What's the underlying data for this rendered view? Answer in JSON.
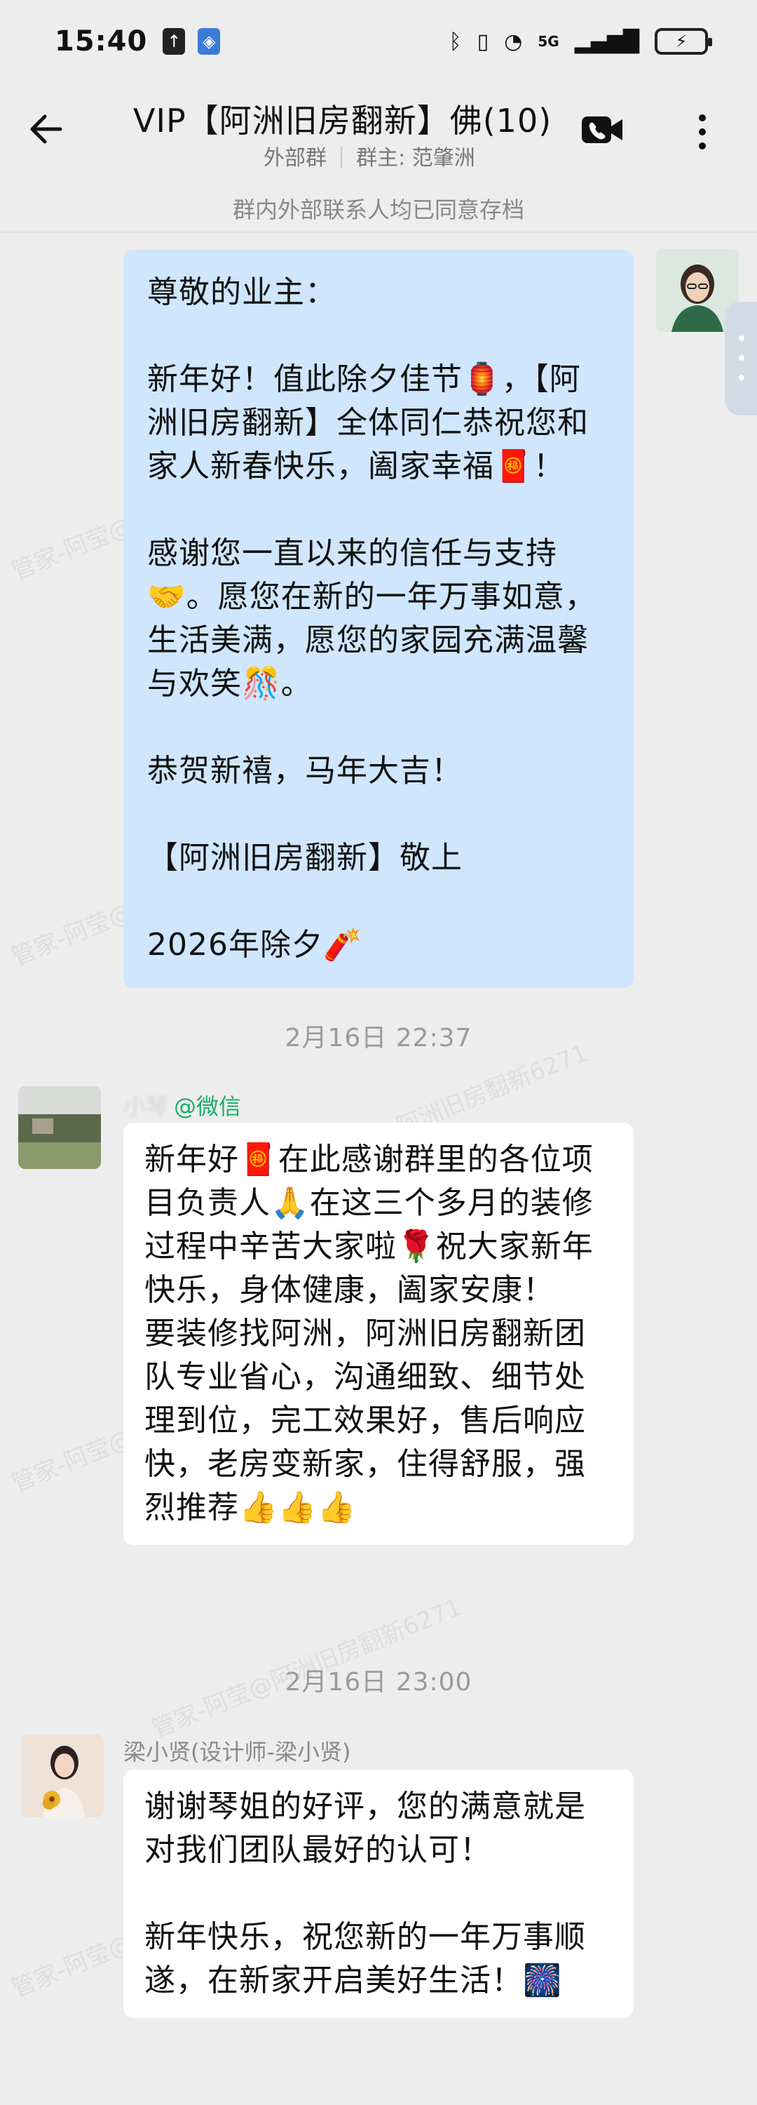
{
  "status_bar": {
    "time": "15:40",
    "network": "5G",
    "battery_icon": "battery-charging-icon"
  },
  "header": {
    "title": "VIP【阿洲旧房翻新】佛(10)",
    "group_type": "外部群",
    "owner": "群主: 范肇洲"
  },
  "notice": "群内外部联系人均已同意存档",
  "watermark": "管家-阿莹@阿洲旧房翻新6271",
  "messages": [
    {
      "sender": "me",
      "text": "尊敬的业主：\n\n新年好！值此除夕佳节🏮，【阿洲旧房翻新】全体同仁恭祝您和家人新春快乐，阖家幸福🧧！\n\n感谢您一直以来的信任与支持🤝。愿您在新的一年万事如意，生活美满，愿您的家园充满温馨与欢笑🎊。\n\n恭贺新禧，马年大吉！\n\n【阿洲旧房翻新】敬上\n\n2026年除夕🧨"
    },
    {
      "timestamp": "2月16日  22:37",
      "sender_name": "小琴",
      "sender_tag": "@微信",
      "text": "新年好🧧在此感谢群里的各位项目负责人🙏在这三个多月的装修过程中辛苦大家啦🌹祝大家新年快乐，身体健康，阖家安康！\n要装修找阿洲，阿洲旧房翻新团队专业省心，沟通细致、细节处理到位，完工效果好，售后响应快，老房变新家，住得舒服，强烈推荐👍👍👍"
    },
    {
      "timestamp": "2月16日  23:00",
      "sender_name": "梁小贤(设计师-梁小贤)",
      "text": "谢谢琴姐的好评，您的满意就是对我们团队最好的认可！\n\n新年快乐，祝您新的一年万事顺遂，在新家开启美好生活！🎆"
    }
  ]
}
